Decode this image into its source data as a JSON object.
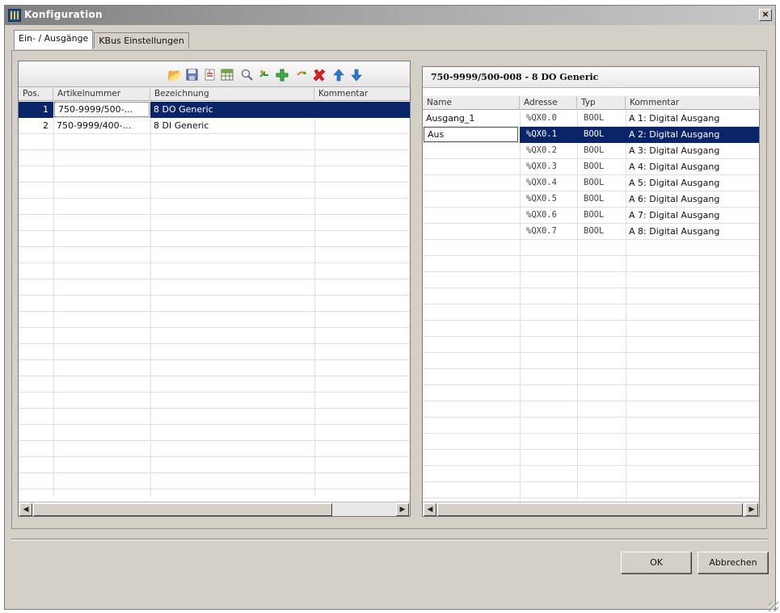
{
  "window": {
    "title": "Konfiguration",
    "close_label": "×"
  },
  "tabs": [
    {
      "label": "Ein- / Ausgänge",
      "active": true
    },
    {
      "label": "KBus Einstellungen",
      "active": false
    }
  ],
  "toolbar": {
    "icons": [
      "folder-open-icon",
      "save-icon",
      "import-icon",
      "table-icon",
      "search-icon",
      "transfer-icon",
      "add-icon",
      "refresh-icon",
      "delete-icon",
      "move-up-icon",
      "move-down-icon"
    ]
  },
  "modules": {
    "columns": [
      "Pos.",
      "Artikelnummer",
      "Bezeichnung",
      "Kommentar"
    ],
    "rows": [
      {
        "pos": "1",
        "article": "750-9999/500-...",
        "name": "8 DO Generic",
        "comment": "",
        "selected": true
      },
      {
        "pos": "2",
        "article": "750-9999/400-...",
        "name": "8 DI Generic",
        "comment": "",
        "selected": false
      }
    ]
  },
  "channels": {
    "title": "750-9999/500-008 - 8 DO Generic",
    "columns": [
      "Name",
      "Adresse",
      "Typ",
      "Kommentar"
    ],
    "rows": [
      {
        "name": "Ausgang_1",
        "address": "%QX0.0",
        "type": "BOOL",
        "comment": "A 1: Digital Ausgang",
        "selected": false
      },
      {
        "name": "Aus",
        "address": "%QX0.1",
        "type": "BOOL",
        "comment": "A 2: Digital Ausgang",
        "selected": true
      },
      {
        "name": "",
        "address": "%QX0.2",
        "type": "BOOL",
        "comment": "A 3: Digital Ausgang",
        "selected": false
      },
      {
        "name": "",
        "address": "%QX0.3",
        "type": "BOOL",
        "comment": "A 4: Digital Ausgang",
        "selected": false
      },
      {
        "name": "",
        "address": "%QX0.4",
        "type": "BOOL",
        "comment": "A 5: Digital Ausgang",
        "selected": false
      },
      {
        "name": "",
        "address": "%QX0.5",
        "type": "BOOL",
        "comment": "A 6: Digital Ausgang",
        "selected": false
      },
      {
        "name": "",
        "address": "%QX0.6",
        "type": "BOOL",
        "comment": "A 7: Digital Ausgang",
        "selected": false
      },
      {
        "name": "",
        "address": "%QX0.7",
        "type": "BOOL",
        "comment": "A 8: Digital Ausgang",
        "selected": false
      }
    ]
  },
  "buttons": {
    "ok": "OK",
    "cancel": "Abbrechen"
  },
  "colors": {
    "selection": "#0a246a",
    "dialog_bg": "#d4d0c8"
  }
}
